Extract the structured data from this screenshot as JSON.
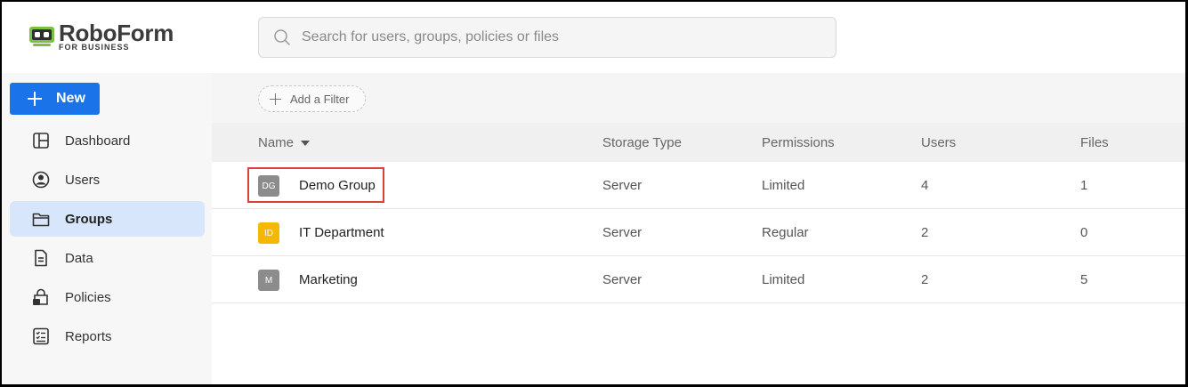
{
  "brand": {
    "name": "RoboForm",
    "sub": "FOR BUSINESS",
    "colors": {
      "mark": "#7bc043",
      "accent": "#1a73e8"
    }
  },
  "search": {
    "placeholder": "Search for users, groups, policies or files",
    "value": ""
  },
  "sidebar": {
    "new_button": "New",
    "items": [
      {
        "label": "Dashboard",
        "icon": "dashboard-icon"
      },
      {
        "label": "Users",
        "icon": "user-circle-icon"
      },
      {
        "label": "Groups",
        "icon": "folder-icon",
        "active": true
      },
      {
        "label": "Data",
        "icon": "document-icon"
      },
      {
        "label": "Policies",
        "icon": "lock-policy-icon"
      },
      {
        "label": "Reports",
        "icon": "checklist-icon"
      }
    ]
  },
  "filter": {
    "add_label": "Add a Filter"
  },
  "table": {
    "columns": [
      "Name",
      "Storage Type",
      "Permissions",
      "Users",
      "Files"
    ],
    "sort_column": "Name",
    "rows": [
      {
        "initials": "DG",
        "name": "Demo Group",
        "storage": "Server",
        "permissions": "Limited",
        "users": "4",
        "files": "1",
        "avatar_color": "#8c8c8c",
        "highlighted": true
      },
      {
        "initials": "ID",
        "name": "IT Department",
        "storage": "Server",
        "permissions": "Regular",
        "users": "2",
        "files": "0",
        "avatar_color": "#f5b800"
      },
      {
        "initials": "M",
        "name": "Marketing",
        "storage": "Server",
        "permissions": "Limited",
        "users": "2",
        "files": "5",
        "avatar_color": "#8c8c8c"
      }
    ]
  }
}
